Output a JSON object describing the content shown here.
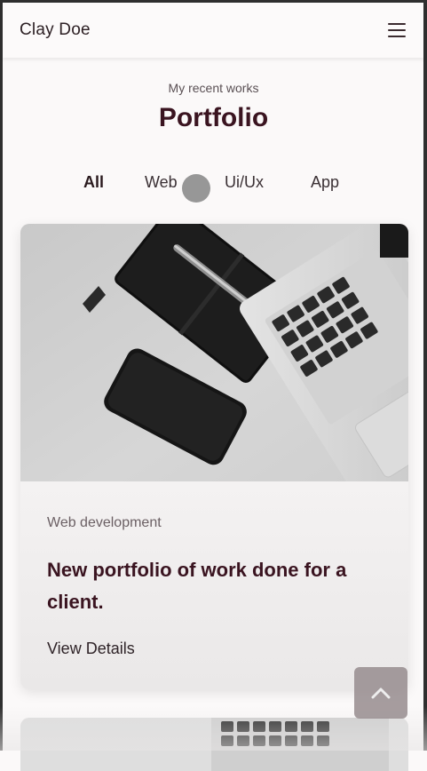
{
  "header": {
    "brand": "Clay Doe",
    "menu_icon": "hamburger-menu-icon"
  },
  "section": {
    "subtitle": "My recent works",
    "title": "Portfolio"
  },
  "filters": [
    {
      "label": "All",
      "active": true
    },
    {
      "label": "Web",
      "active": false
    },
    {
      "label": "Ui/Ux",
      "active": false
    },
    {
      "label": "App",
      "active": false
    }
  ],
  "cards": [
    {
      "category": "Web development",
      "title": "New portfolio of work done for a client.",
      "link_label": "View Details",
      "image": "desk-notebook-phone-laptop-photo"
    }
  ],
  "scroll_top_icon": "chevron-up-icon",
  "colors": {
    "background": "#fbf9f9",
    "title": "#3a1420",
    "scroll_button": "#968c8e"
  }
}
